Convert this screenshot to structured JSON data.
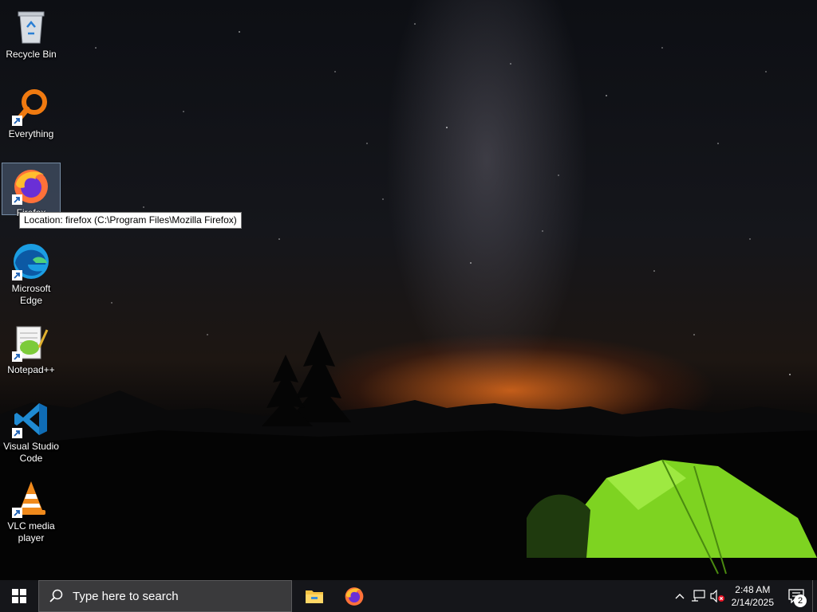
{
  "desktop": {
    "icons": [
      {
        "label": "Recycle Bin",
        "icon": "recycle-bin-icon"
      },
      {
        "label": "Everything",
        "icon": "everything-search-icon"
      },
      {
        "label": "Firefox",
        "icon": "firefox-icon"
      },
      {
        "label": "Microsoft Edge",
        "icon": "edge-icon"
      },
      {
        "label": "Notepad++",
        "icon": "notepad-plus-plus-icon"
      },
      {
        "label": "Visual Studio Code",
        "icon": "vscode-icon"
      },
      {
        "label": "VLC media player",
        "icon": "vlc-icon"
      }
    ],
    "tooltip": "Location: firefox (C:\\Program Files\\Mozilla Firefox)"
  },
  "taskbar": {
    "search_placeholder": "Type here to search",
    "pinned": [
      "file-explorer-icon",
      "firefox-icon"
    ],
    "time": "2:48 AM",
    "date": "2/14/2025",
    "notification_count": "2"
  },
  "colors": {
    "taskbar_bg": "#15161a",
    "search_bg": "#3a3a3c",
    "tent_green": "#7ed321",
    "horizon_glow": "#ff7a1e"
  }
}
